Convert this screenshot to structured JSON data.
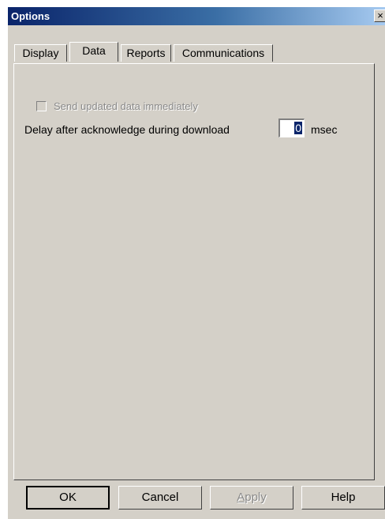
{
  "window": {
    "title": "Options",
    "close_glyph": "×"
  },
  "tabs": [
    {
      "label": "Display",
      "active": false
    },
    {
      "label": "Data",
      "active": true
    },
    {
      "label": "Reports",
      "active": false
    },
    {
      "label": "Communications",
      "active": false
    }
  ],
  "data_tab": {
    "send_immediately": {
      "label": "Send updated data immediately",
      "checked": false,
      "enabled": false
    },
    "delay": {
      "label": "Delay after acknowledge during download",
      "value": "0",
      "unit": "msec"
    }
  },
  "buttons": {
    "ok": "OK",
    "cancel": "Cancel",
    "apply_first": "A",
    "apply_rest": "pply",
    "help": "Help"
  },
  "colors": {
    "face": "#d4d0c8",
    "title_start": "#0a246a",
    "title_end": "#a6caf0"
  }
}
